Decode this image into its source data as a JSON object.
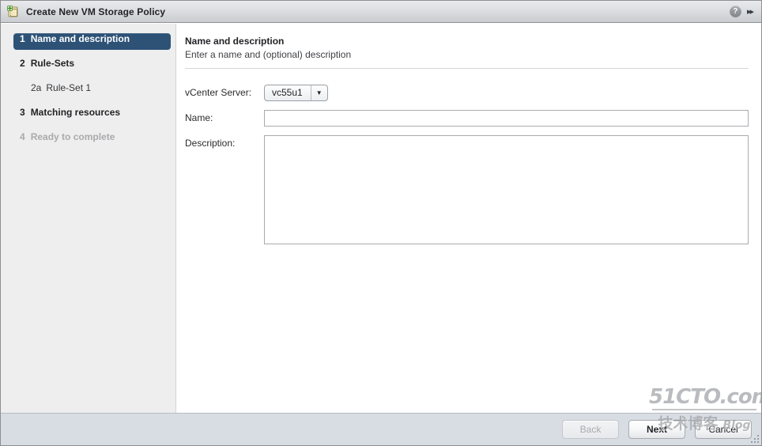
{
  "window": {
    "title": "Create New VM Storage Policy",
    "title_icon": "create-new-policy-icon",
    "help_icon": "?",
    "expand_icon": "▸▸"
  },
  "sidebar": {
    "items": [
      {
        "num": "1",
        "label": "Name and description",
        "state": "selected"
      },
      {
        "num": "2",
        "label": "Rule-Sets",
        "state": "normal"
      },
      {
        "num": "2a",
        "label": "Rule-Set 1",
        "state": "sub"
      },
      {
        "num": "3",
        "label": "Matching resources",
        "state": "normal"
      },
      {
        "num": "4",
        "label": "Ready to complete",
        "state": "disabled"
      }
    ]
  },
  "content": {
    "title": "Name and description",
    "subtitle": "Enter a name and (optional) description",
    "fields": {
      "vcenter_label": "vCenter Server:",
      "vcenter_value": "vc55u1",
      "vcenter_arrow": "▼",
      "name_label": "Name:",
      "name_value": "",
      "name_placeholder": "",
      "description_label": "Description:",
      "description_value": "",
      "description_placeholder": ""
    }
  },
  "footer": {
    "back_label": "Back",
    "next_label": "Next",
    "cancel_label": "Cancel"
  },
  "watermark": {
    "main": "51CTO.com",
    "cn": "技术博客",
    "blog": "Blog"
  },
  "colors": {
    "accent": "#2d5276",
    "titlebar": "#dcdee1",
    "sidebar": "#eeeeee",
    "footer": "#d8dce3"
  }
}
